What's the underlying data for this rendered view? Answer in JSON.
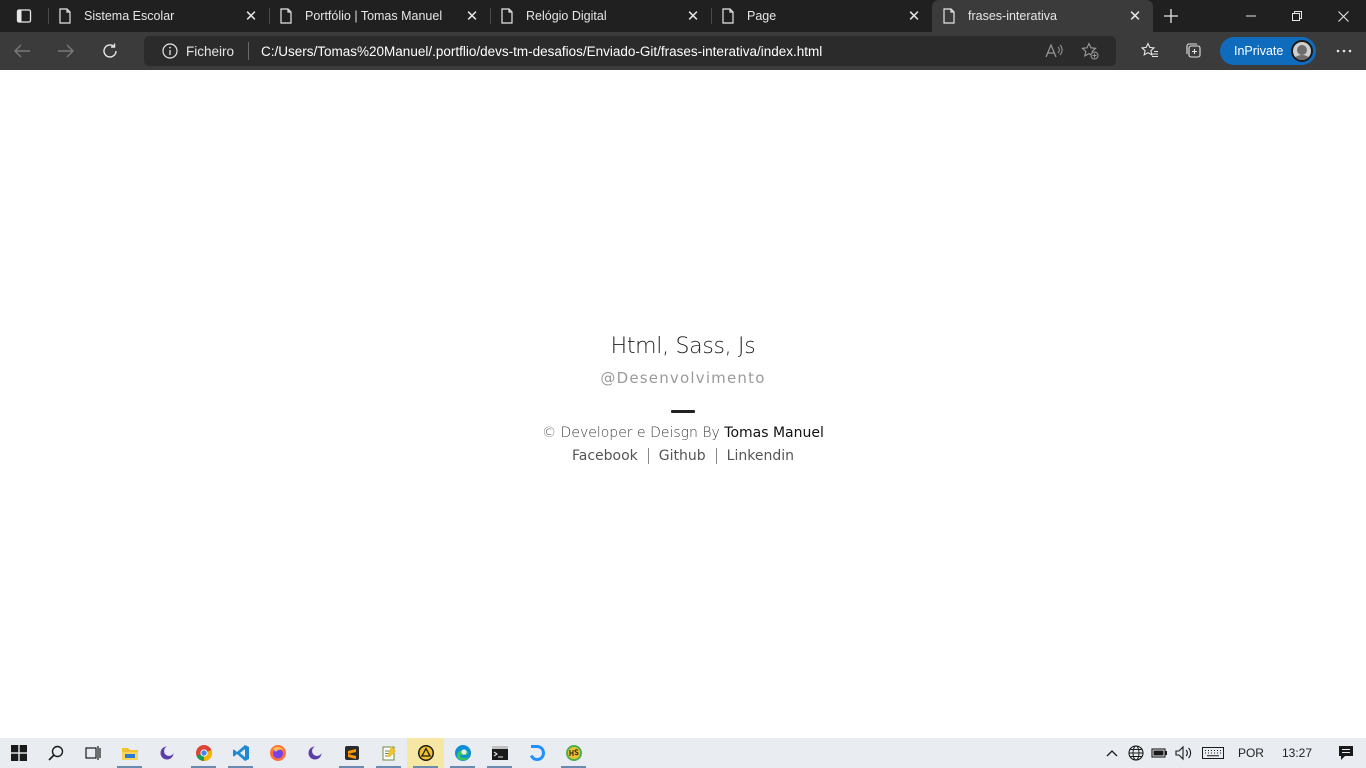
{
  "browser": {
    "tabs": [
      {
        "title": "Sistema Escolar",
        "active": false
      },
      {
        "title": "Portfólio | Tomas Manuel",
        "active": false
      },
      {
        "title": "Relógio Digital",
        "active": false
      },
      {
        "title": "Page",
        "active": false
      },
      {
        "title": "frases-interativa",
        "active": true
      }
    ],
    "address": {
      "scheme_label": "Ficheiro",
      "url": "C:/Users/Tomas%20Manuel/.portflio/devs-tm-desafios/Enviado-Git/frases-interativa/index.html"
    },
    "inprivate_label": "InPrivate"
  },
  "page": {
    "headline": "Html, Sass, Js",
    "handle": "@Desenvolvimento",
    "credit_prefix": "© Developer e Deisgn By ",
    "credit_author": "Tomas Manuel",
    "links": [
      "Facebook",
      "Github",
      "Linkendin"
    ]
  },
  "taskbar": {
    "language": "POR",
    "time": "13:27"
  }
}
